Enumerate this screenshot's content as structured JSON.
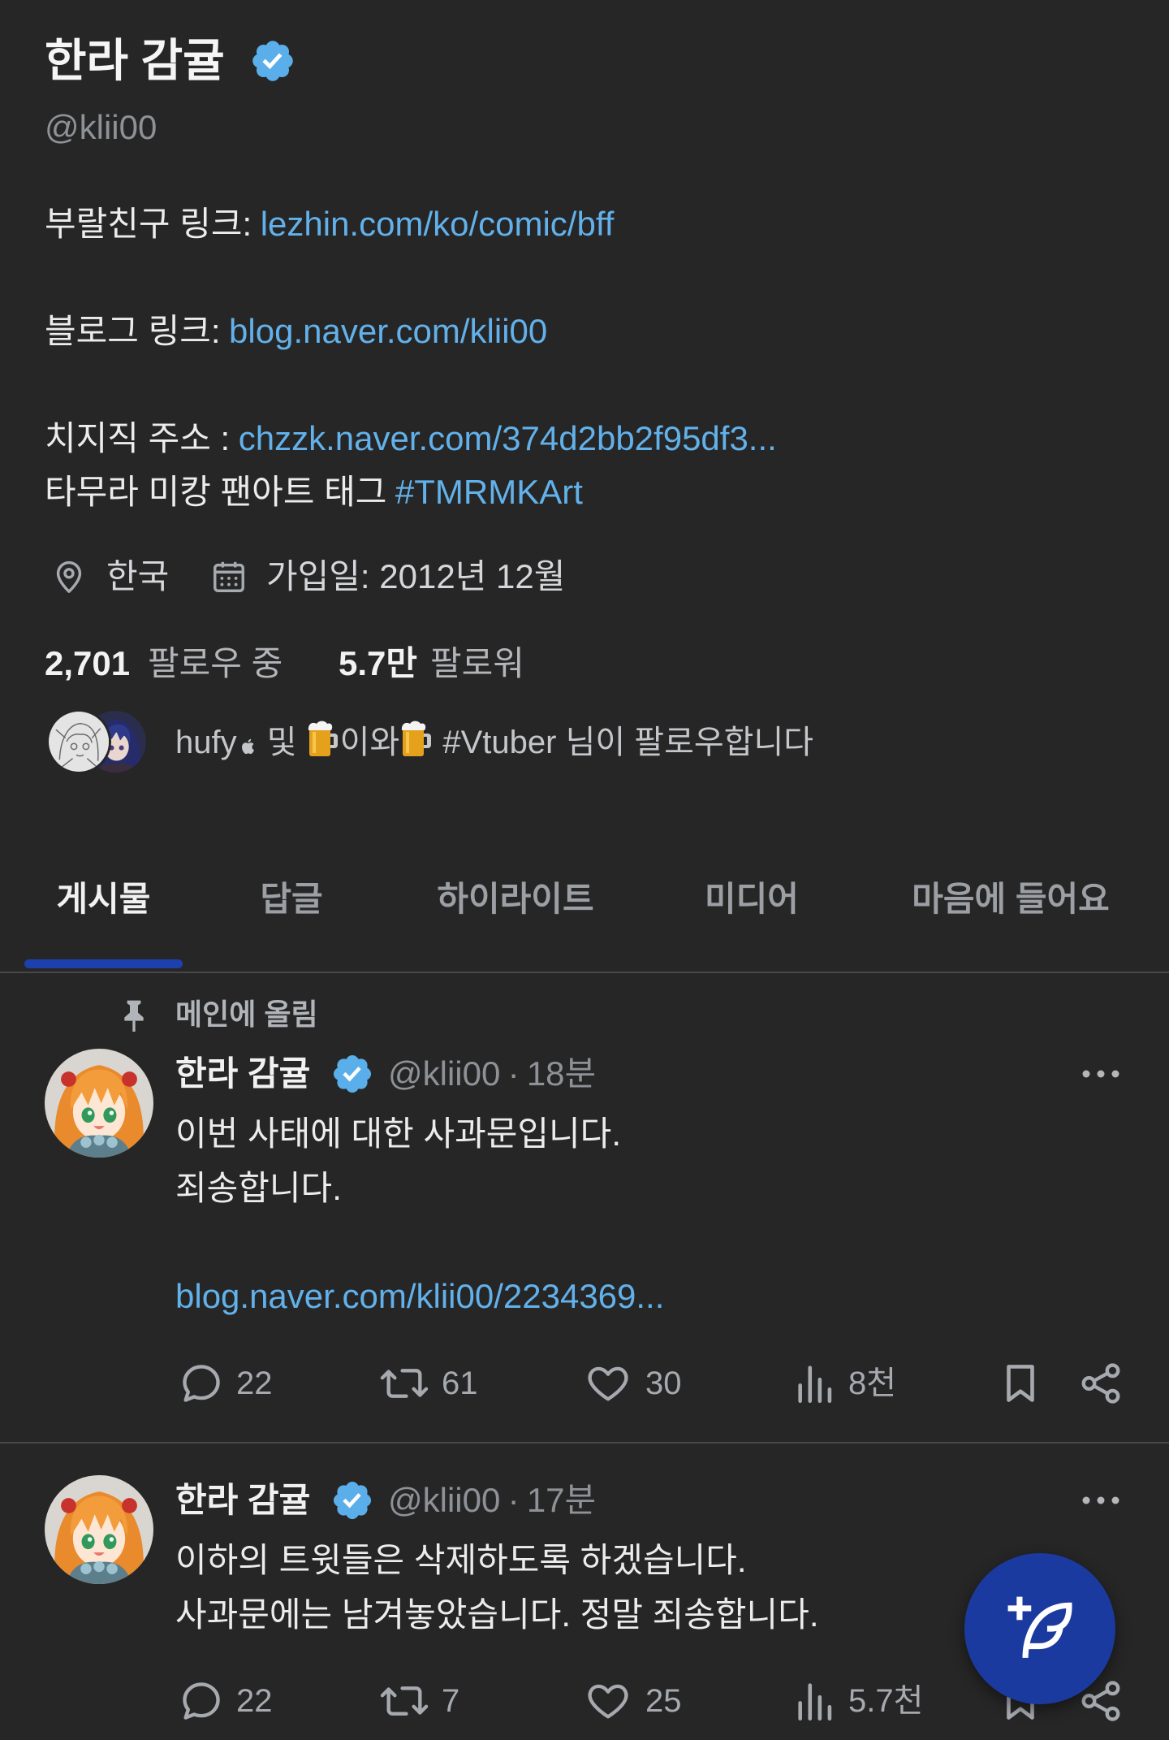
{
  "profile": {
    "name": "한라 감귤",
    "handle": "@klii00",
    "bio": [
      {
        "label": "부랄친구 링크:",
        "link": "lezhin.com/ko/comic/bff"
      },
      {
        "label": "블로그 링크:",
        "link": "blog.naver.com/klii00"
      },
      {
        "label": "치지직 주소 :",
        "link": "chzzk.naver.com/374d2bb2f95df3..."
      },
      {
        "label": "타무라 미캉 팬아트 태그",
        "link": "#TMRMKArt"
      }
    ],
    "location": "한국",
    "joined": "가입일: 2012년 12월",
    "following_count": "2,701",
    "following_label": "팔로우 중",
    "followers_count": "5.7만",
    "followers_label": "팔로워",
    "followed_by": [
      "hufy",
      " 및 ",
      "이와",
      " #Vtuber 님이 팔로우합니다"
    ]
  },
  "tabs": [
    "게시물",
    "답글",
    "하이라이트",
    "미디어",
    "마음에 들어요"
  ],
  "active_tab": 0,
  "tweets": [
    {
      "pinned_label": "메인에 올림",
      "name": "한라 감귤",
      "handle": "@klii00",
      "separator": "·",
      "time": "18분",
      "lines": [
        "이번 사태에 대한 사과문입니다.",
        "죄송합니다."
      ],
      "link": "blog.naver.com/klii00/2234369...",
      "replies": "22",
      "retweets": "61",
      "likes": "30",
      "views": "8천"
    },
    {
      "name": "한라 감귤",
      "handle": "@klii00",
      "separator": "·",
      "time": "17분",
      "lines": [
        "이하의 트윗들은 삭제하도록 하겠습니다.",
        "사과문에는 남겨놓았습니다. 정말 죄송합니다."
      ],
      "replies": "22",
      "retweets": "7",
      "likes": "25",
      "views": "5.7천"
    }
  ],
  "icons": {
    "verified": "verified-badge-icon",
    "location": "location-pin-icon",
    "calendar": "calendar-icon",
    "pin": "pushpin-icon",
    "reply": "reply-icon",
    "retweet": "retweet-icon",
    "like": "heart-icon",
    "views": "views-chart-icon",
    "bookmark": "bookmark-icon",
    "share": "share-icon",
    "more": "more-dots-icon",
    "compose": "compose-feather-icon",
    "apple": "apple-logo-icon",
    "beer": "beer-mug-icon"
  },
  "colors": {
    "background": "#262626",
    "text": "#ececec",
    "muted": "#8e9196",
    "link": "#62b1ea",
    "accent": "#1e3fae",
    "verified": "#5aaeea",
    "fab": "#1b3a9f"
  }
}
